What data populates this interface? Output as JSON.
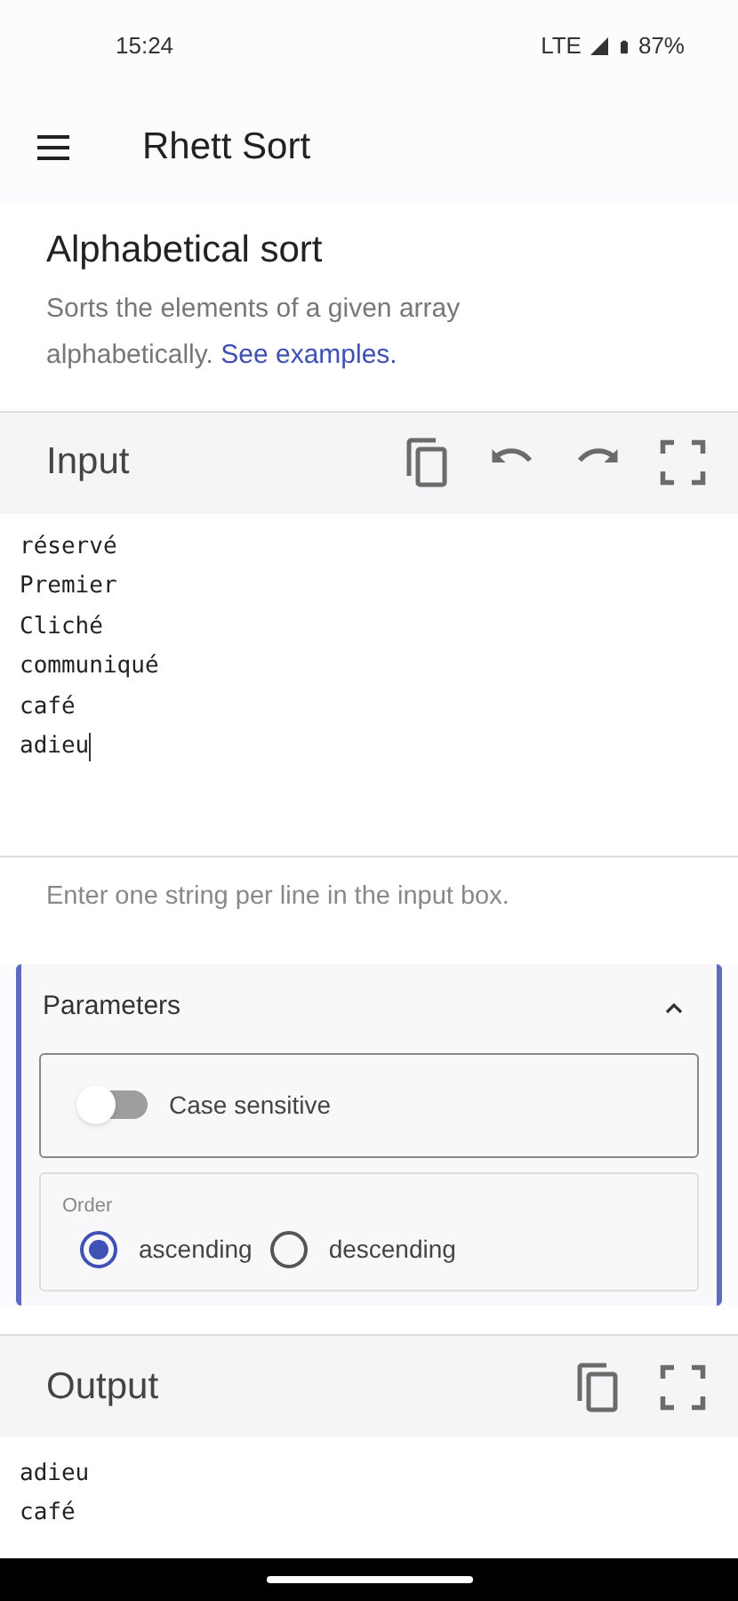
{
  "status_bar": {
    "time": "15:24",
    "network": "LTE",
    "battery": "87%"
  },
  "app_bar": {
    "title": "Rhett Sort"
  },
  "intro": {
    "title": "Alphabetical sort",
    "description": "Sorts the elements of a given array alphabetically.",
    "link": "See examples."
  },
  "input": {
    "title": "Input",
    "lines": [
      "réservé",
      "Premier",
      "Cliché",
      "communiqué",
      "café",
      "adieu"
    ],
    "helper": "Enter one string per line in the input box."
  },
  "parameters": {
    "title": "Parameters",
    "expanded": true,
    "case_sensitive": {
      "label": "Case sensitive",
      "on": false
    },
    "order": {
      "label": "Order",
      "options": [
        {
          "label": "ascending",
          "selected": true
        },
        {
          "label": "descending",
          "selected": false
        }
      ]
    }
  },
  "output": {
    "title": "Output",
    "lines": [
      "adieu",
      "café"
    ]
  }
}
